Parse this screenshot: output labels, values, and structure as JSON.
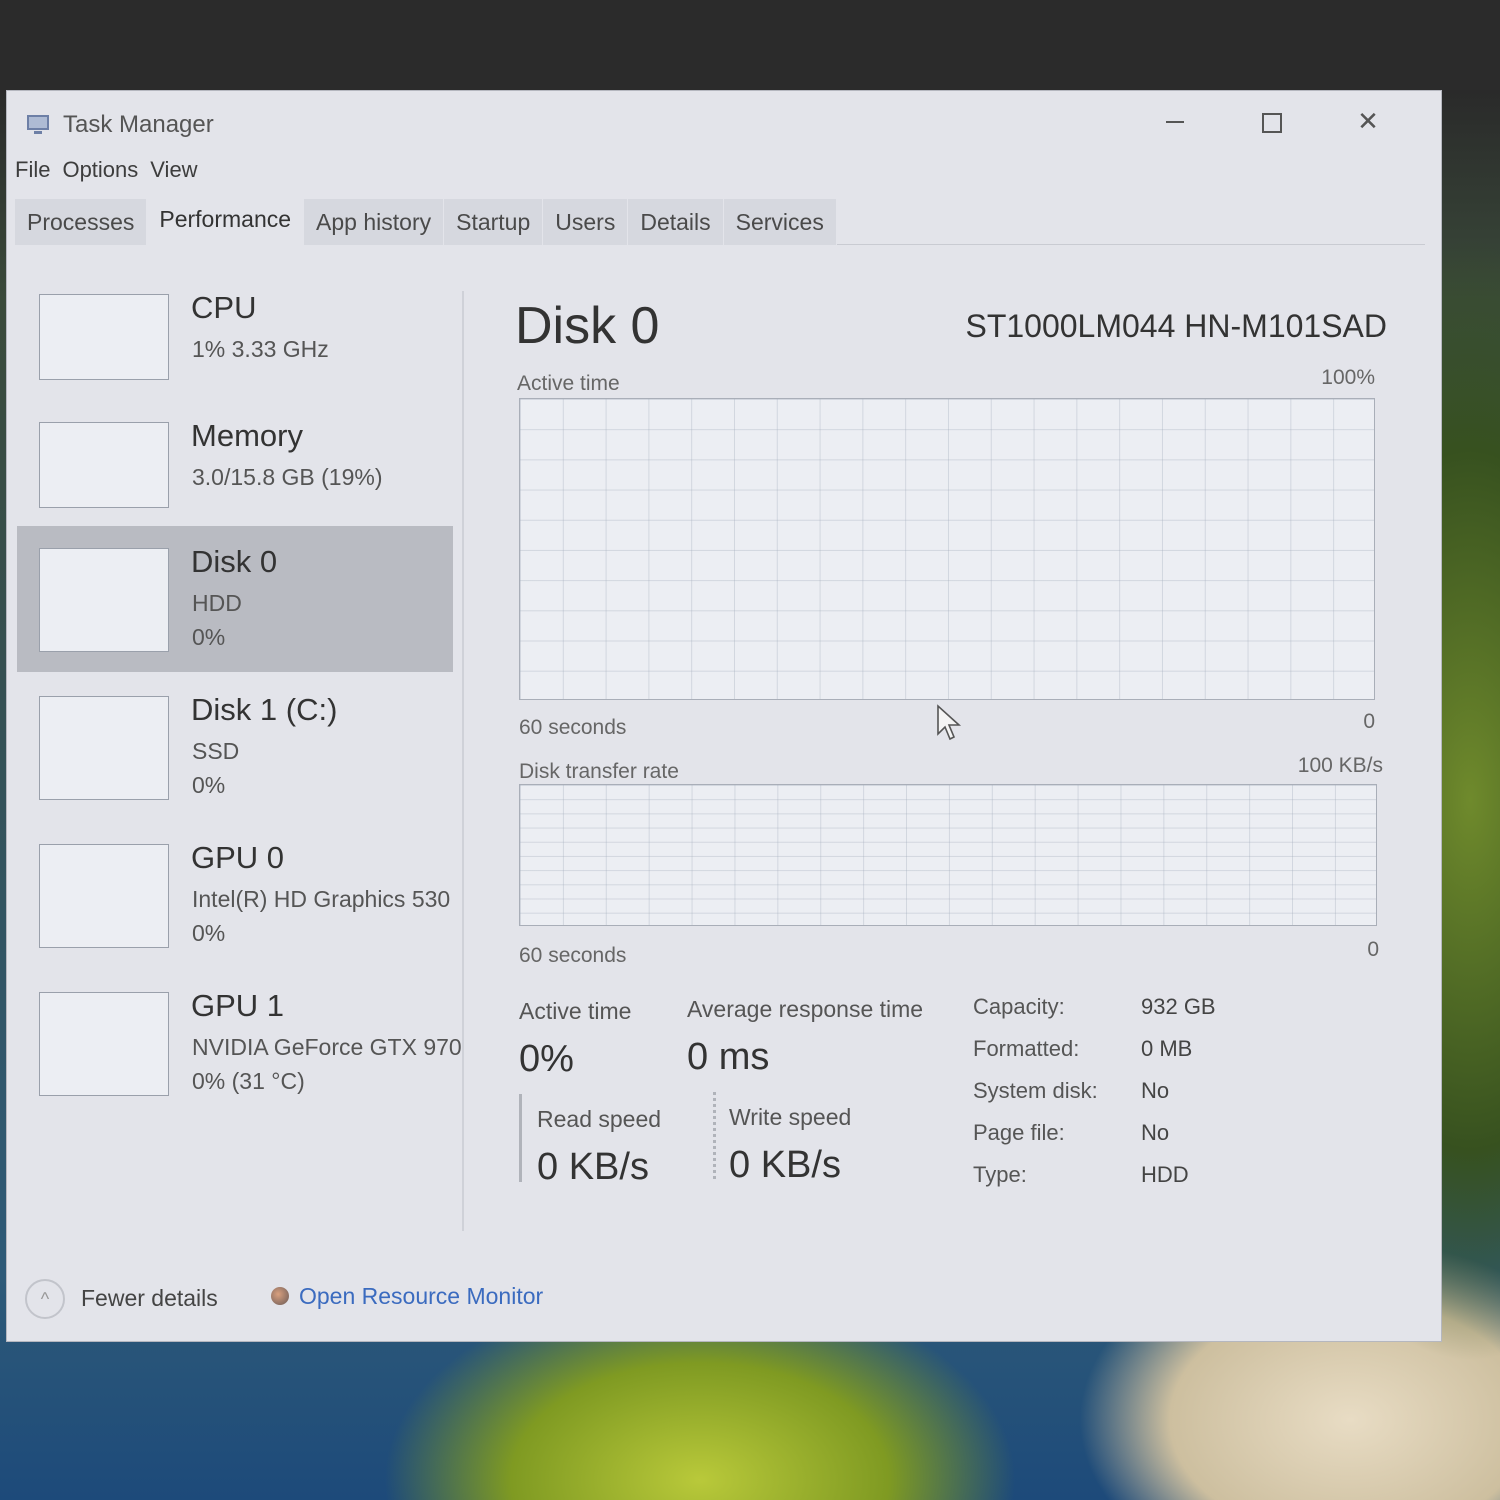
{
  "window": {
    "title": "Task Manager",
    "controls": {
      "minimize": "–",
      "maximize": "",
      "close": "✕"
    }
  },
  "menu": [
    "File",
    "Options",
    "View"
  ],
  "tabs": [
    "Processes",
    "Performance",
    "App history",
    "Startup",
    "Users",
    "Details",
    "Services"
  ],
  "active_tab": "Performance",
  "sidebar": {
    "items": [
      {
        "name": "CPU",
        "sub1": "1%  3.33 GHz",
        "sub2": ""
      },
      {
        "name": "Memory",
        "sub1": "3.0/15.8 GB (19%)",
        "sub2": ""
      },
      {
        "name": "Disk 0",
        "sub1": "HDD",
        "sub2": "0%",
        "selected": true
      },
      {
        "name": "Disk 1 (C:)",
        "sub1": "SSD",
        "sub2": "0%"
      },
      {
        "name": "GPU 0",
        "sub1": "Intel(R) HD Graphics 530",
        "sub2": "0%"
      },
      {
        "name": "GPU 1",
        "sub1": "NVIDIA GeForce GTX 970",
        "sub2": "0%  (31 °C)"
      }
    ]
  },
  "main": {
    "title": "Disk 0",
    "model": "ST1000LM044 HN-M101SAD",
    "graph1": {
      "label": "Active time",
      "max": "100%",
      "time": "60 seconds",
      "min": "0"
    },
    "graph2": {
      "label": "Disk transfer rate",
      "max": "100 KB/s",
      "time": "60 seconds",
      "min": "0"
    },
    "stats": {
      "active_time_label": "Active time",
      "active_time_value": "0%",
      "avg_response_label": "Average response time",
      "avg_response_value": "0 ms",
      "read_label": "Read speed",
      "read_value": "0 KB/s",
      "write_label": "Write speed",
      "write_value": "0 KB/s"
    },
    "properties": [
      {
        "key": "Capacity:",
        "value": "932 GB"
      },
      {
        "key": "Formatted:",
        "value": "0 MB"
      },
      {
        "key": "System disk:",
        "value": "No"
      },
      {
        "key": "Page file:",
        "value": "No"
      },
      {
        "key": "Type:",
        "value": "HDD"
      }
    ]
  },
  "footer": {
    "fewer_details": "Fewer details",
    "resource_monitor": "Open Resource Monitor"
  }
}
